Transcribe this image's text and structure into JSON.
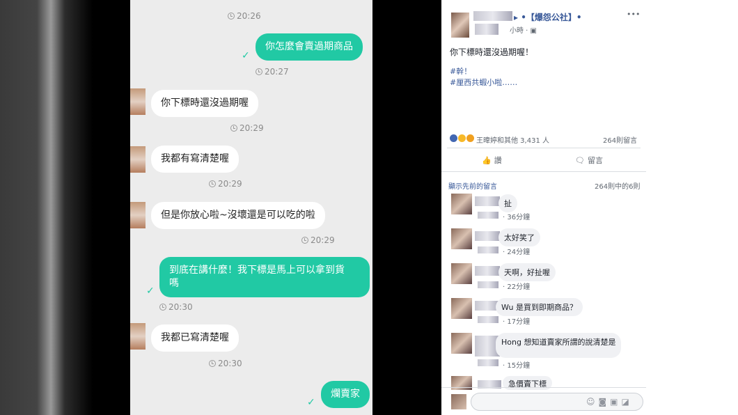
{
  "chat": {
    "messages": [
      {
        "time": "20:26"
      },
      {
        "text": "你怎麼會賣過期商品",
        "time": "20:27"
      },
      {
        "text": "你下標時還沒過期喔",
        "time": "20:29"
      },
      {
        "text": "我都有寫清楚喔",
        "time": "20:29"
      },
      {
        "text": "但是你放心啦~沒壞還是可以吃的啦",
        "time": "20:29"
      },
      {
        "text_line1": "到底在講什麼！我下標是馬上可以拿到貨",
        "text_line2": "嗎",
        "time": "20:30"
      },
      {
        "text": "我都已寫清楚喔",
        "time": "20:30"
      },
      {
        "text": "爛賣家"
      }
    ]
  },
  "post": {
    "group": "▸ •【爆怨公社】•",
    "meta": "小時 · ▣",
    "more": "•••",
    "body": "你下標時還沒過期喔！",
    "tag1": "#幹！",
    "tag2": "#厘西共蝦小啦……",
    "reactions": "王暐婷和其他 3,431 人",
    "comments_count": "264則留言",
    "like": "讚",
    "comment": "留言",
    "prev_comments": "顯示先前的留言",
    "paging": "264則中的6則",
    "comments": [
      {
        "text": "扯",
        "time": "· 36分鐘"
      },
      {
        "text": "太好笑了",
        "time": "· 24分鐘"
      },
      {
        "text": "天啊，好扯喔",
        "time": "· 22分鐘"
      },
      {
        "text": "Wu 是買到即期商品？",
        "time": "· 17分鐘"
      },
      {
        "text": "Hong  想知道賣家所謂的說清楚是",
        "time": "· 15分鐘"
      },
      {
        "text": "急價賣下標",
        "time": ""
      }
    ]
  }
}
